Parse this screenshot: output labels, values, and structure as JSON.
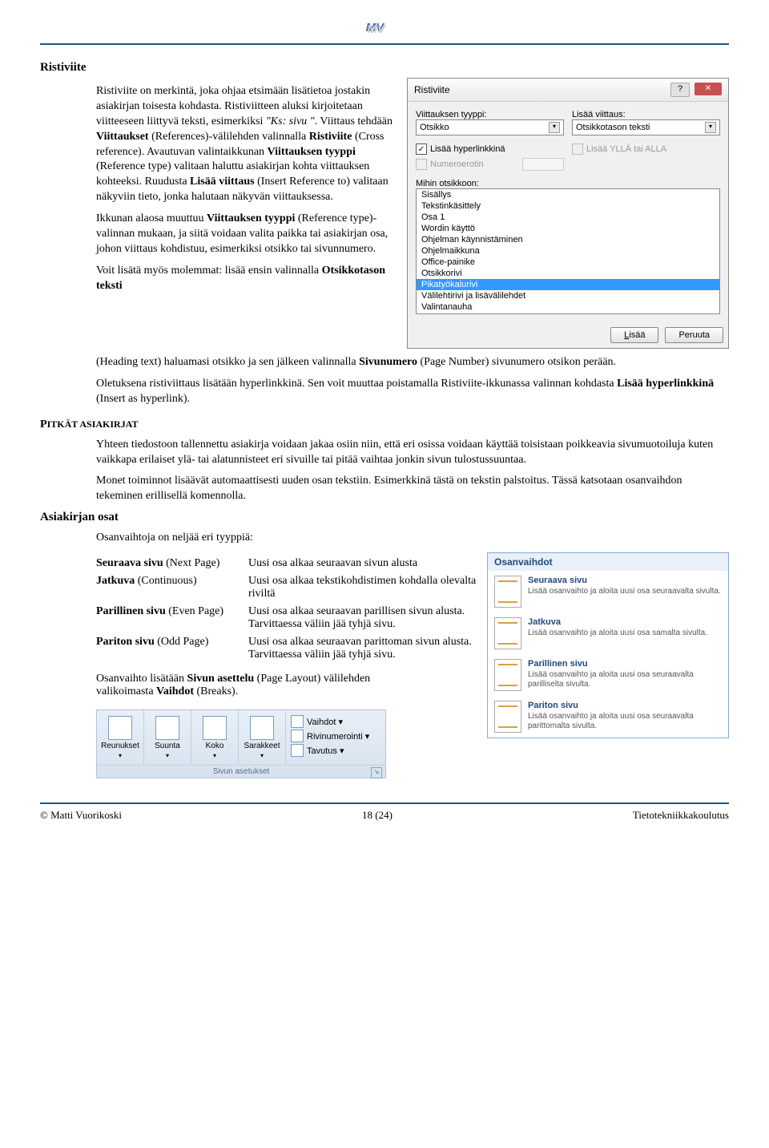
{
  "section1_title": "Ristiviite",
  "p1": "Ristiviite on merkintä, joka ohjaa etsimään lisätietoa jostakin asiakirjan toisesta kohdasta. Ristiviitteen aluksi kirjoitetaan viitteeseen liittyvä teksti, esimerkiksi ",
  "p1_italic": "\"Ks: sivu \"",
  "p1_cont": ". Viittaus tehdään ",
  "p1_b1": "Viittaukset ",
  "p1_r1": "(References)-välilehden valinnalla ",
  "p1_b2": "Ristiviite",
  "p1_r2": " (Cross reference). Avautuvan valintaikkunan ",
  "p1_b3": "Viittauksen tyyppi",
  "p1_r3": " (Reference type) valitaan haluttu asiakirjan kohta viittauksen kohteeksi. Ruudusta ",
  "p1_b4": "Lisää viittaus",
  "p1_r4": " (Insert Reference to) valitaan näkyviin tieto, jonka halutaan näkyvän viittauksessa.",
  "p2a": "Ikkunan alaosa muuttuu ",
  "p2b": "Viittauksen tyyppi",
  "p2c": " (Reference type)- valinnan mukaan, ja siitä voidaan valita paikka tai asiakirjan osa, johon viittaus kohdistuu, esimerkiksi otsikko tai sivunnumero.",
  "p3a": "Voit lisätä myös molemmat: lisää ensin valinnalla ",
  "p3b": "Otsikkotason teksti",
  "p3c": " (Heading text) haluamasi otsikko ja sen jälkeen valinnalla ",
  "p3d": "Sivunumero",
  "p3e": " (Page Number) sivunumero otsikon perään.",
  "p4a": "Oletuksena ristiviittaus lisätään hyperlinkkinä. Sen voit muuttaa poistamalla Ristiviite-ikkunassa valinnan kohdasta ",
  "p4b": "Lisää hyperlinkkinä",
  "p4c": " (Insert as hyperlink).",
  "section2_title": "PITKÄT ASIAKIRJAT",
  "p5": "Yhteen tiedostoon tallennettu asiakirja voidaan jakaa osiin niin, että eri osissa voidaan käyttää toisistaan poikkeavia sivumuotoiluja kuten vaikkapa erilaiset ylä- tai alatunnisteet eri sivuille tai pitää vaihtaa jonkin sivun tulostussuuntaa.",
  "p6": "Monet toiminnot lisäävät automaattisesti uuden osan tekstiin. Esimerkkinä tästä on tekstin palstoitus. Tässä katsotaan osanvaihdon tekeminen erillisellä komennolla.",
  "section3_title": "Asiakirjan osat",
  "p7": "Osanvaihtoja on neljää eri tyyppiä:",
  "defs": [
    {
      "term_b": "Seuraava sivu",
      "term_r": " (Next Page)",
      "def": "Uusi osa alkaa seuraavan sivun alusta"
    },
    {
      "term_b": "Jatkuva",
      "term_r": " (Continuous)",
      "def": "Uusi osa alkaa tekstikohdistimen kohdalla olevalta riviltä"
    },
    {
      "term_b": "Parillinen sivu",
      "term_r": " (Even Page)",
      "def": "Uusi osa alkaa seuraavan parillisen sivun alusta. Tarvittaessa väliin jää tyhjä sivu."
    },
    {
      "term_b": "Pariton sivu",
      "term_r": " (Odd Page)",
      "def": "Uusi osa alkaa seuraavan parittoman sivun alusta. Tarvittaessa väliin jää tyhjä sivu."
    }
  ],
  "p8a": " Osanvaihto lisätään ",
  "p8b": "Sivun asettelu",
  "p8c": " (Page Layout) välilehden valikoimasta ",
  "p8d": "Vaihdot",
  "p8e": " (Breaks).",
  "dialog": {
    "title": "Ristiviite",
    "lbl_type": "Viittauksen tyyppi:",
    "val_type": "Otsikko",
    "lbl_insert": "Lisää viittaus:",
    "val_insert": "Otsikkotason teksti",
    "chk_hyper": "Lisää hyperlinkkinä",
    "chk_above": "Lisää YLLÄ tai ALLA",
    "chk_numsep_lbl": "Numeroerotin",
    "lbl_which": "Mihin otsikkoon:",
    "items": [
      "Sisällys",
      "Tekstinkäsittely",
      "Osa 1",
      "  Wordin käyttö",
      "    Ohjelman käynnistäminen",
      "    Ohjelmaikkuna",
      "    Office-painike",
      "    Otsikkorivi",
      "    Pikatyökalurivi",
      "    Välilehtirivi ja lisävälilehdet",
      "    Valintanauha"
    ],
    "sel_index": 8,
    "btn_insert": "Lisää",
    "btn_cancel": "Peruuta"
  },
  "osanvaihdot": {
    "title": "Osanvaihdot",
    "items": [
      {
        "t": "Seuraava sivu",
        "d": "Lisää osanvaihto ja aloita uusi osa seuraavalta sivulta."
      },
      {
        "t": "Jatkuva",
        "d": "Lisää osanvaihto ja aloita uusi osa samalta sivulta."
      },
      {
        "t": "Parillinen sivu",
        "d": "Lisää osanvaihto ja aloita uusi osa seuraavalta parilliselta sivulta."
      },
      {
        "t": "Pariton sivu",
        "d": "Lisää osanvaihto ja aloita uusi osa seuraavalta parittomalta sivulta."
      }
    ]
  },
  "ribbon": {
    "big": [
      "Reunukset",
      "Suunta",
      "Koko",
      "Sarakkeet"
    ],
    "items": [
      "Vaihdot ▾",
      "Rivinumerointi ▾",
      "Tavutus ▾"
    ],
    "group_label": "Sivun asetukset"
  },
  "footer": {
    "left": "© Matti Vuorikoski",
    "center": "18 (24)",
    "right": "Tietotekniikkakoulutus"
  }
}
